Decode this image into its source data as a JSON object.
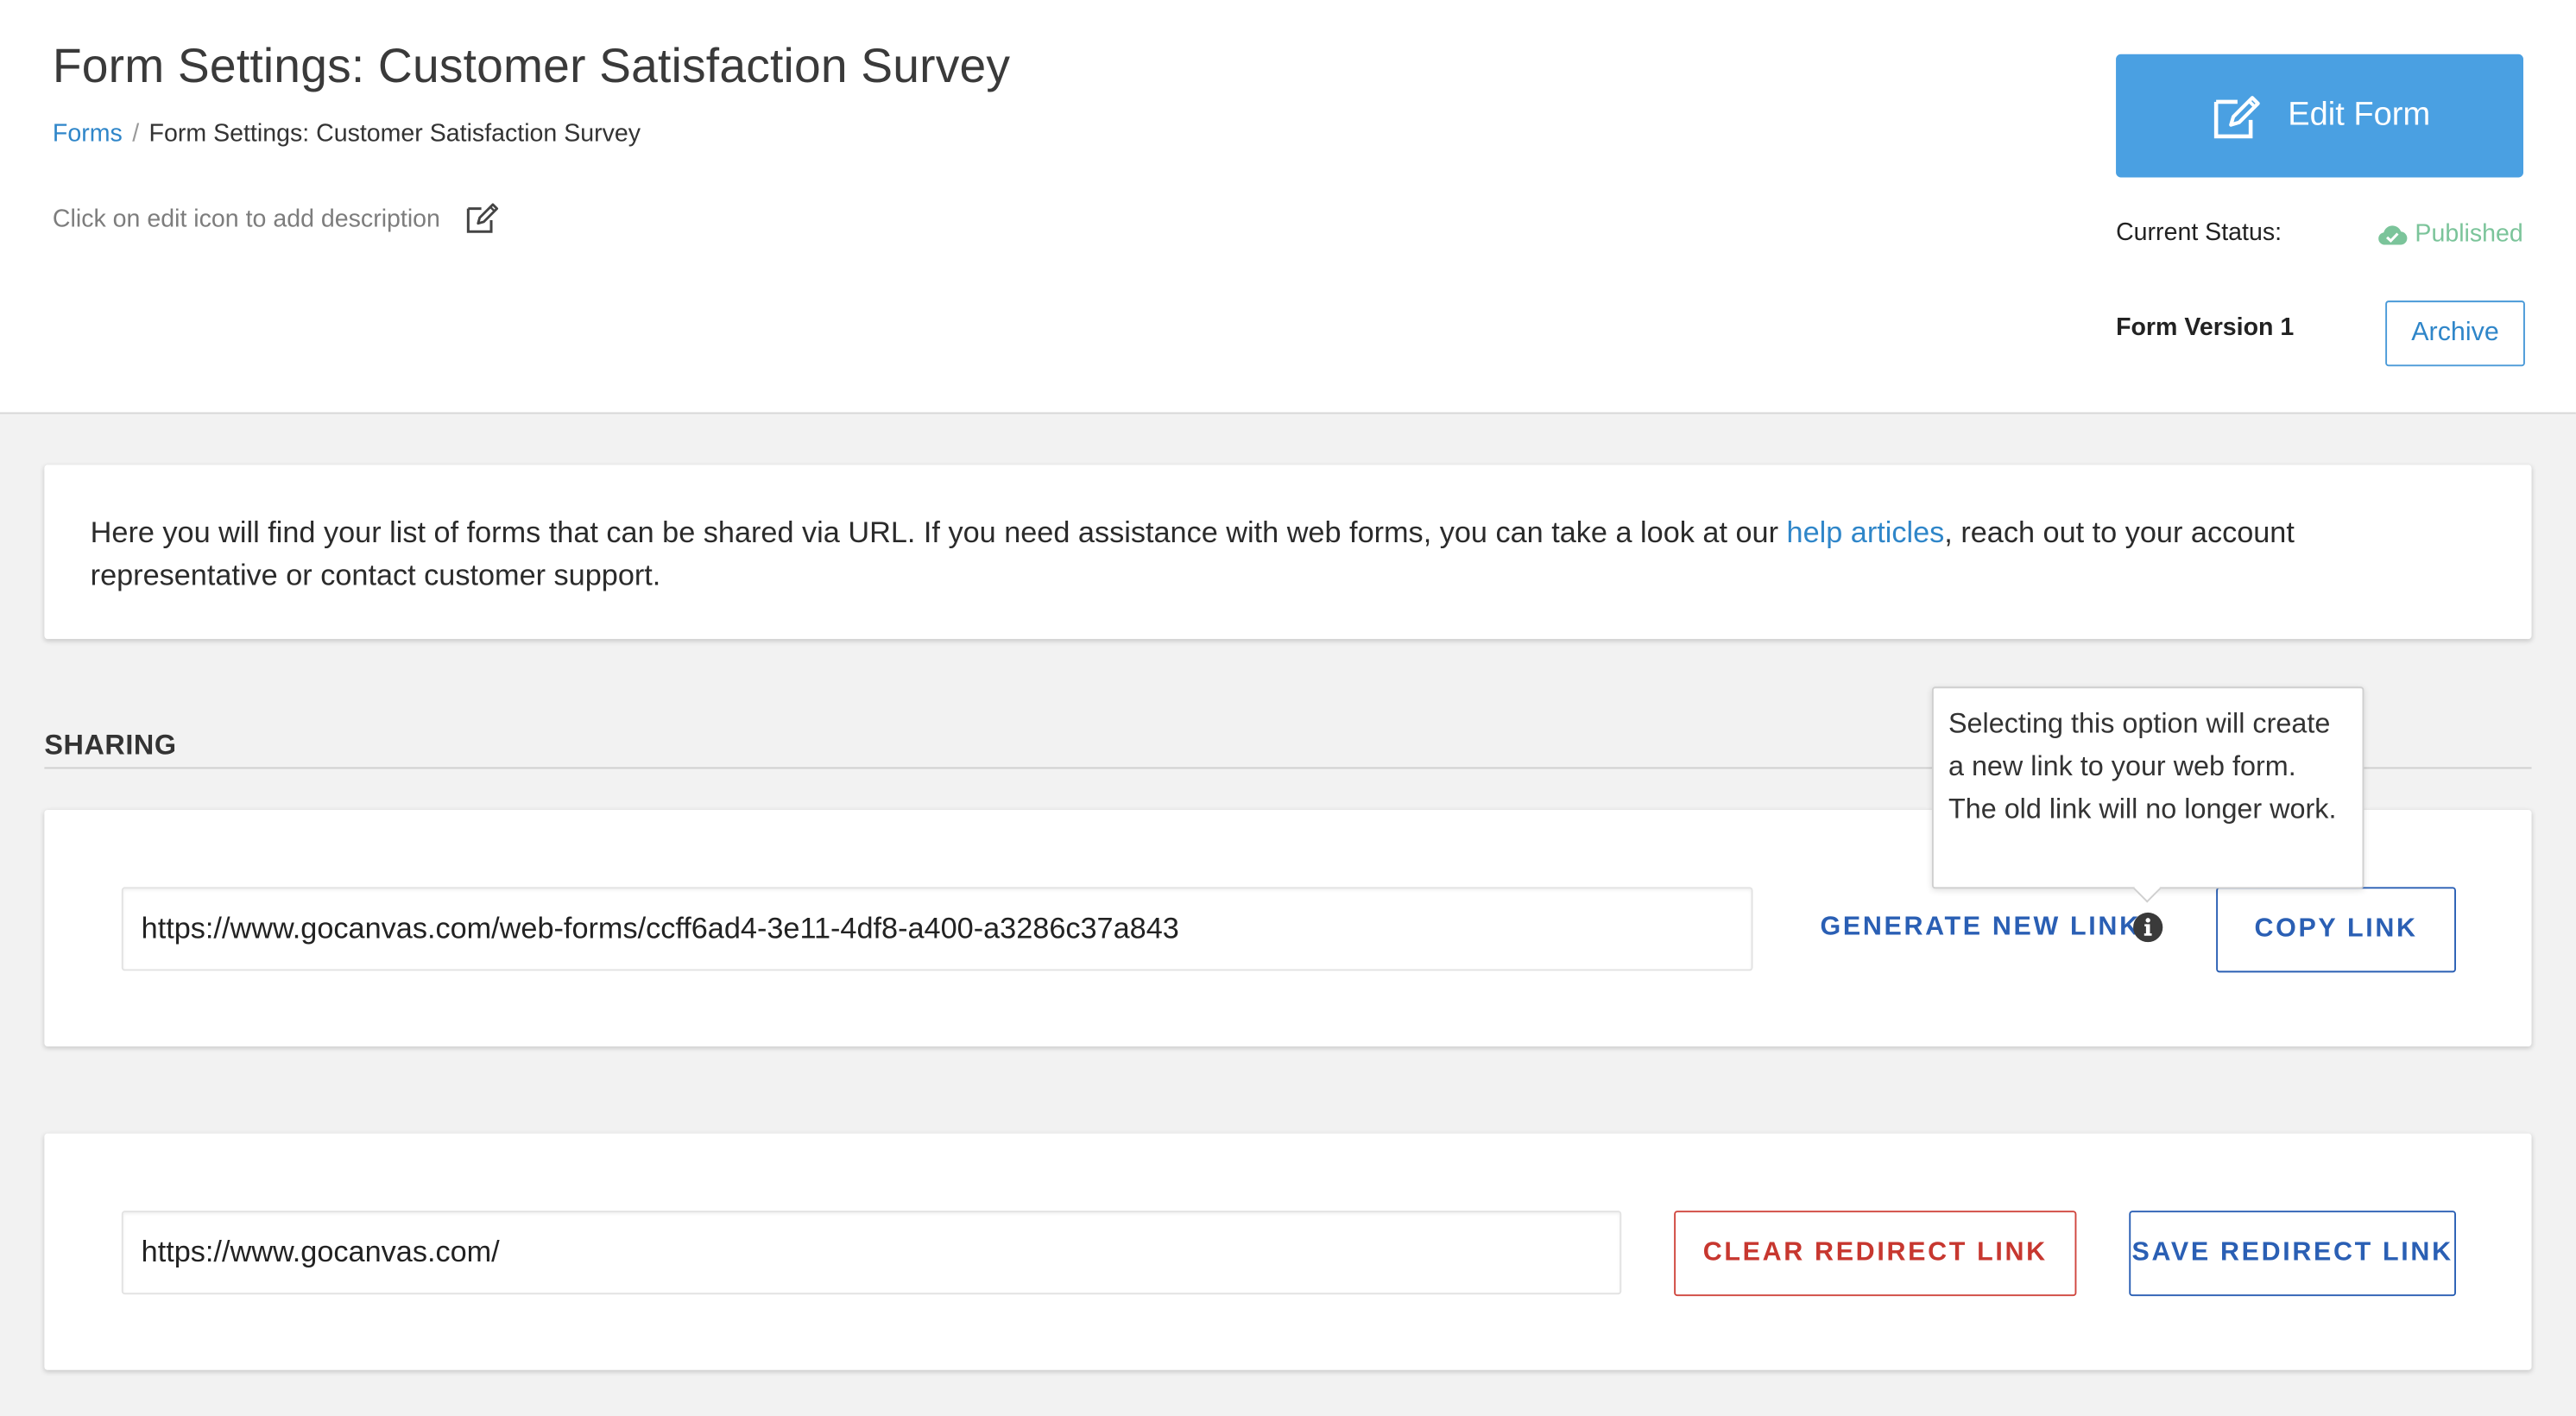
{
  "header": {
    "title": "Form Settings: Customer Satisfaction Survey",
    "breadcrumb": {
      "root": "Forms",
      "separator": "/",
      "current": "Form Settings: Customer Satisfaction Survey"
    },
    "description_hint": "Click on edit icon to add description",
    "edit_form_label": "Edit Form",
    "status_label": "Current Status:",
    "status_value": "Published",
    "version_label": "Form Version 1",
    "archive_label": "Archive"
  },
  "info": {
    "text_before": "Here you will find your list of forms that can be shared via URL. If you need assistance with web forms, you can take a look at our ",
    "link_text": "help articles",
    "text_after": ", reach out to your account representative or contact customer support."
  },
  "sharing": {
    "heading": "SHARING",
    "share_url": "https://www.gocanvas.com/web-forms/ccff6ad4-3e11-4df8-a400-a3286c37a843",
    "generate_label": "GENERATE NEW LINK",
    "copy_label": "COPY LINK",
    "tooltip_text": "Selecting this option will create a new link to your web form. The old link will no longer work."
  },
  "redirect": {
    "url": "https://www.gocanvas.com/",
    "clear_label": "CLEAR REDIRECT LINK",
    "save_label": "SAVE REDIRECT LINK"
  },
  "colors": {
    "primary_button": "#4aa0e2",
    "link": "#2f86c9",
    "action_blue": "#2a5fb4",
    "danger": "#c7372f",
    "published": "#7bc49a"
  },
  "icons": {
    "edit_description": "pencil-square-icon",
    "edit_form": "pencil-square-icon",
    "status": "cloud-check-icon",
    "generate_info": "info-circle-icon"
  }
}
